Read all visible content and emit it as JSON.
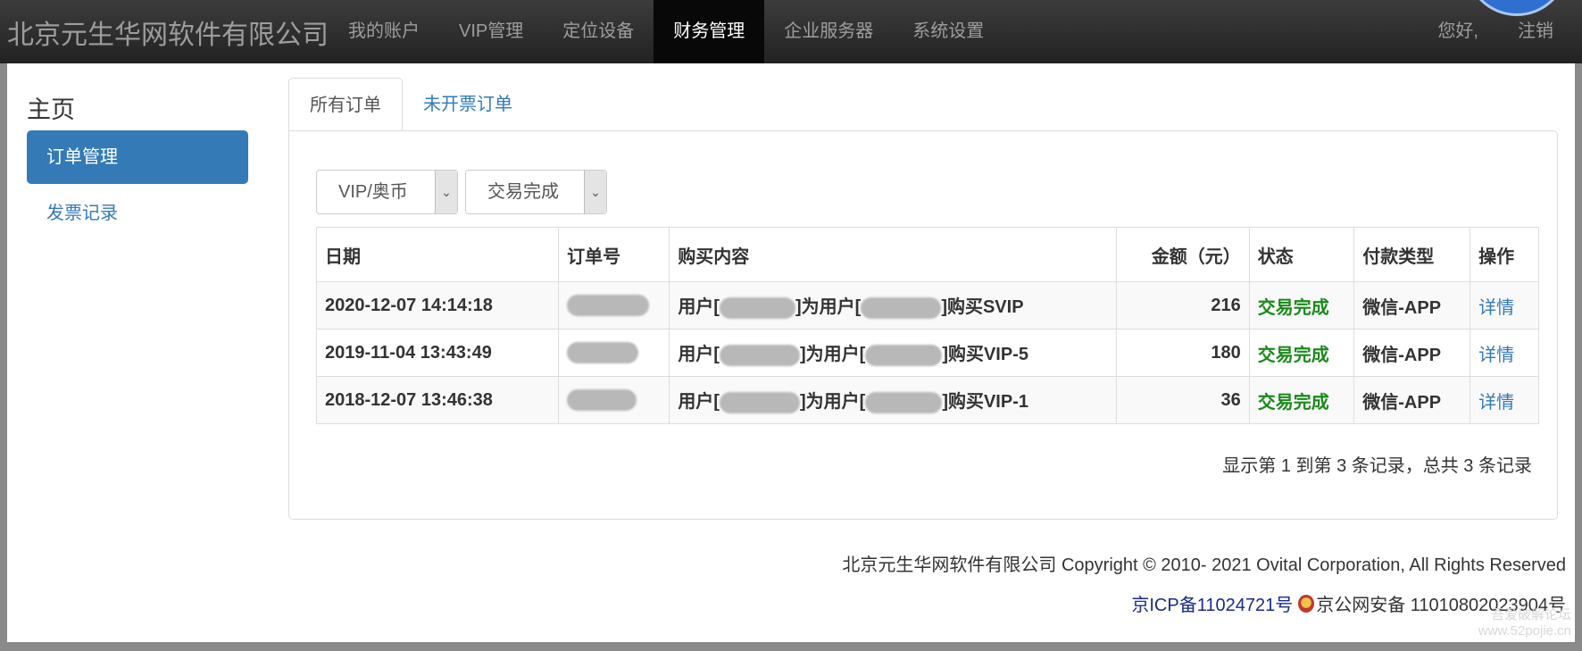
{
  "header": {
    "brand": "北京元生华网软件有限公司",
    "nav": [
      "我的账户",
      "VIP管理",
      "定位设备",
      "财务管理",
      "企业服务器",
      "系统设置"
    ],
    "active_nav": 3,
    "greeting": "您好,",
    "logout": "注销"
  },
  "sidebar": {
    "title": "主页",
    "items": [
      {
        "label": "订单管理",
        "active": true
      },
      {
        "label": "发票记录",
        "active": false
      }
    ]
  },
  "tabs": [
    {
      "label": "所有订单",
      "active": true
    },
    {
      "label": "未开票订单",
      "active": false
    }
  ],
  "filters": {
    "type": "VIP/奥币",
    "status": "交易完成"
  },
  "table": {
    "headers": [
      "日期",
      "订单号",
      "购买内容",
      "金额（元）",
      "状态",
      "付款类型",
      "操作"
    ],
    "rows": [
      {
        "date": "2020-12-07 14:14:18",
        "content_prefix": "用户[",
        "content_mid": "]为用户[",
        "content_suffix": "]购买SVIP",
        "amount": "216",
        "status": "交易完成",
        "pay_type": "微信-APP",
        "action": "详情"
      },
      {
        "date": "2019-11-04 13:43:49",
        "content_prefix": "用户[",
        "content_mid": "]为用户[",
        "content_suffix": "]购买VIP-5",
        "amount": "180",
        "status": "交易完成",
        "pay_type": "微信-APP",
        "action": "详情"
      },
      {
        "date": "2018-12-07 13:46:38",
        "content_prefix": "用户[",
        "content_mid": "]为用户[",
        "content_suffix": "]购买VIP-1",
        "amount": "36",
        "status": "交易完成",
        "pay_type": "微信-APP",
        "action": "详情"
      }
    ]
  },
  "records_text": "显示第 1 到第 3 条记录，总共 3 条记录",
  "footer": {
    "copyright": "北京元生华网软件有限公司 Copyright © 2010- 2021 Ovital Corporation, All Rights Reserved",
    "icp": "京ICP备11024721号",
    "police": "京公网安备 11010802023904号"
  },
  "watermark": {
    "line1": "吾爱破解论坛",
    "line2": "www.52pojie.cn"
  },
  "colors": {
    "primary": "#337ab7",
    "success": "#1a8a1a",
    "navbar": "#222222"
  }
}
